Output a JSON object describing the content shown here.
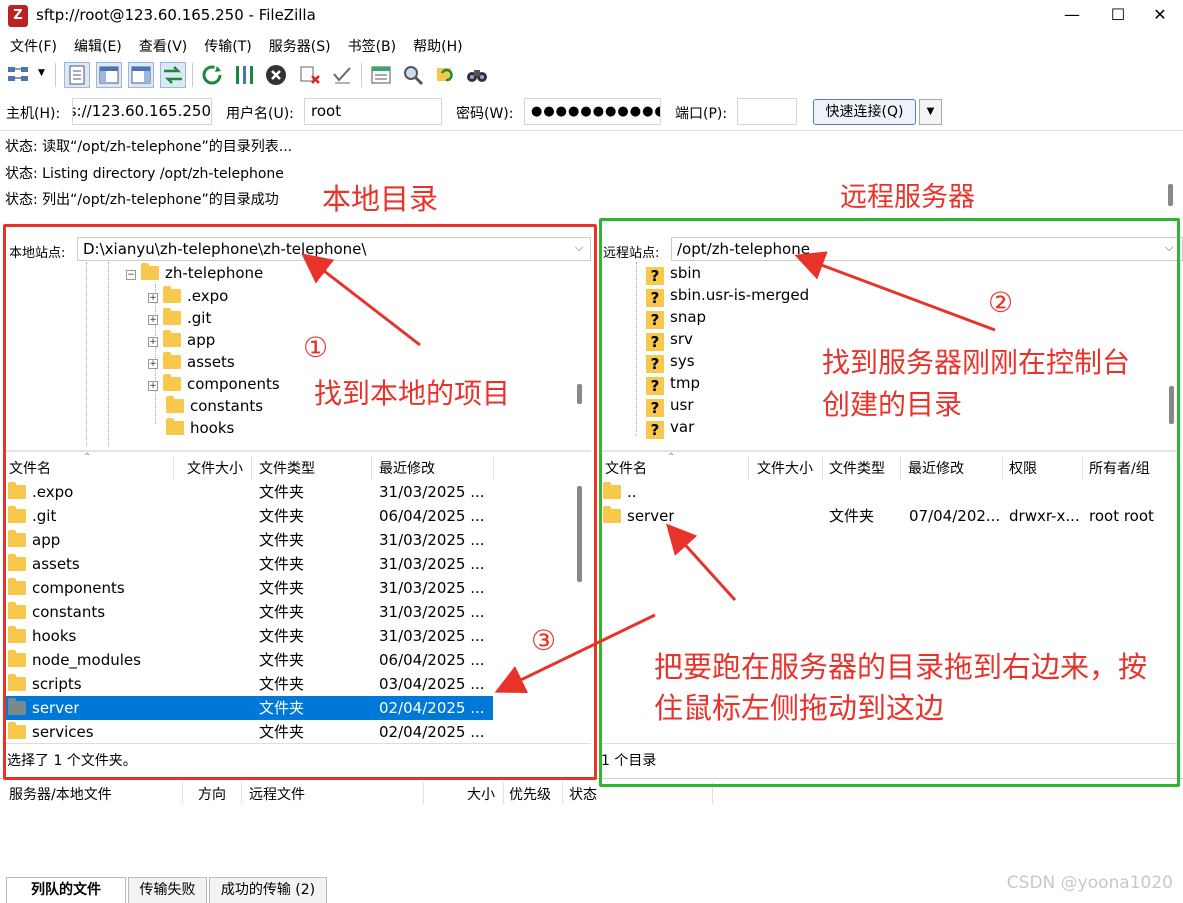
{
  "window": {
    "title": "sftp://root@123.60.165.250 - FileZilla",
    "app_icon": "Z",
    "minimize": "—",
    "maximize": "☐",
    "close": "✕"
  },
  "menu": [
    "文件(F)",
    "编辑(E)",
    "查看(V)",
    "传输(T)",
    "服务器(S)",
    "书签(B)",
    "帮助(H)"
  ],
  "quickconnect": {
    "host_label": "主机(H):",
    "host_value": "s://123.60.165.250",
    "user_label": "用户名(U):",
    "user_value": "root",
    "pass_label": "密码(W):",
    "pass_value": "●●●●●●●●●●●",
    "port_label": "端口(P):",
    "port_value": "",
    "button": "快速连接(Q)",
    "dropdown": "▼"
  },
  "log": [
    "状态: 读取“/opt/zh-telephone”的目录列表...",
    "状态: Listing directory /opt/zh-telephone",
    "状态: 列出“/opt/zh-telephone”的目录成功"
  ],
  "local": {
    "site_label": "本地站点:",
    "path": "D:\\xianyu\\zh-telephone\\zh-telephone\\",
    "tree_root": "zh-telephone",
    "tree_children": [
      {
        "name": ".expo",
        "exp": "+"
      },
      {
        "name": ".git",
        "exp": "+"
      },
      {
        "name": "app",
        "exp": "+"
      },
      {
        "name": "assets",
        "exp": "+"
      },
      {
        "name": "components",
        "exp": "+"
      },
      {
        "name": "constants",
        "exp": ""
      },
      {
        "name": "hooks",
        "exp": ""
      }
    ],
    "columns": [
      "文件名",
      "文件大小",
      "文件类型",
      "最近修改"
    ],
    "files": [
      {
        "name": ".expo",
        "type": "文件夹",
        "modified": "31/03/2025 ..."
      },
      {
        "name": ".git",
        "type": "文件夹",
        "modified": "06/04/2025 ..."
      },
      {
        "name": "app",
        "type": "文件夹",
        "modified": "31/03/2025 ..."
      },
      {
        "name": "assets",
        "type": "文件夹",
        "modified": "31/03/2025 ..."
      },
      {
        "name": "components",
        "type": "文件夹",
        "modified": "31/03/2025 ..."
      },
      {
        "name": "constants",
        "type": "文件夹",
        "modified": "31/03/2025 ..."
      },
      {
        "name": "hooks",
        "type": "文件夹",
        "modified": "31/03/2025 ..."
      },
      {
        "name": "node_modules",
        "type": "文件夹",
        "modified": "06/04/2025 ..."
      },
      {
        "name": "scripts",
        "type": "文件夹",
        "modified": "03/04/2025 ..."
      },
      {
        "name": "server",
        "type": "文件夹",
        "modified": "02/04/2025 ..."
      },
      {
        "name": "services",
        "type": "文件夹",
        "modified": "02/04/2025 ..."
      }
    ],
    "status": "选择了 1 个文件夹。"
  },
  "remote": {
    "site_label": "远程站点:",
    "path": "/opt/zh-telephone",
    "tree": [
      "sbin",
      "sbin.usr-is-merged",
      "snap",
      "srv",
      "sys",
      "tmp",
      "usr",
      "var"
    ],
    "columns": [
      "文件名",
      "文件大小",
      "文件类型",
      "最近修改",
      "权限",
      "所有者/组"
    ],
    "files": [
      {
        "name": "..",
        "type": "",
        "modified": "",
        "perm": "",
        "owner": ""
      },
      {
        "name": "server",
        "type": "文件夹",
        "modified": "07/04/202...",
        "perm": "drwxr-x...",
        "owner": "root root"
      }
    ],
    "status": "1 个目录"
  },
  "queue": {
    "columns": [
      "服务器/本地文件",
      "方向",
      "远程文件",
      "大小",
      "优先级",
      "状态"
    ],
    "tabs": [
      "列队的文件",
      "传输失败",
      "成功的传输 (2)"
    ]
  },
  "annotations": {
    "local_title": "本地目录",
    "remote_title": "远程服务器",
    "n1": "①",
    "t1": "找到本地的项目",
    "n2": "②",
    "t2a": "找到服务器刚刚在控制台",
    "t2b": "创建的目录",
    "n3": "③",
    "t3a": "把要跑在服务器的目录拖到右边来，按",
    "t3b": "住鼠标左侧拖动到这边"
  },
  "watermark": "CSDN @yoona1020",
  "colors": {
    "annotation_red": "#e8332b",
    "annotation_green": "#2fb52f",
    "selection": "#0078d7",
    "folder": "#f7c84b"
  }
}
